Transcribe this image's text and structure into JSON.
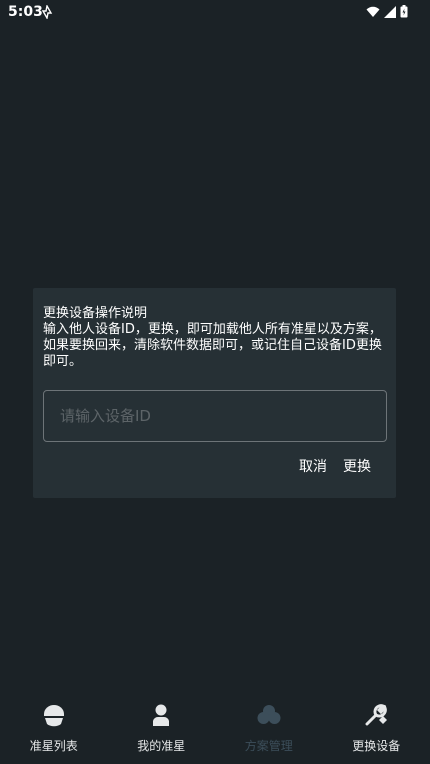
{
  "status_bar": {
    "time": "5:03"
  },
  "dialog": {
    "title": "更换设备操作说明",
    "message": "输入他人设备ID，更换，即可加载他人所有准星以及方案，如果要换回来，清除软件数据即可，或记住自己设备ID更换即可。",
    "input_placeholder": "请输入设备ID",
    "input_value": "",
    "cancel_label": "取消",
    "confirm_label": "更换"
  },
  "bottom_nav": {
    "items": [
      {
        "label": "准星列表",
        "icon": "helmet-icon",
        "active": false
      },
      {
        "label": "我的准星",
        "icon": "person-icon",
        "active": false
      },
      {
        "label": "方案管理",
        "icon": "cloud-icon",
        "active": true
      },
      {
        "label": "更换设备",
        "icon": "wrench-icon",
        "active": false
      }
    ]
  },
  "colors": {
    "background": "#1b2226",
    "dialog": "#263035",
    "active_nav": "#3c4e5a"
  }
}
